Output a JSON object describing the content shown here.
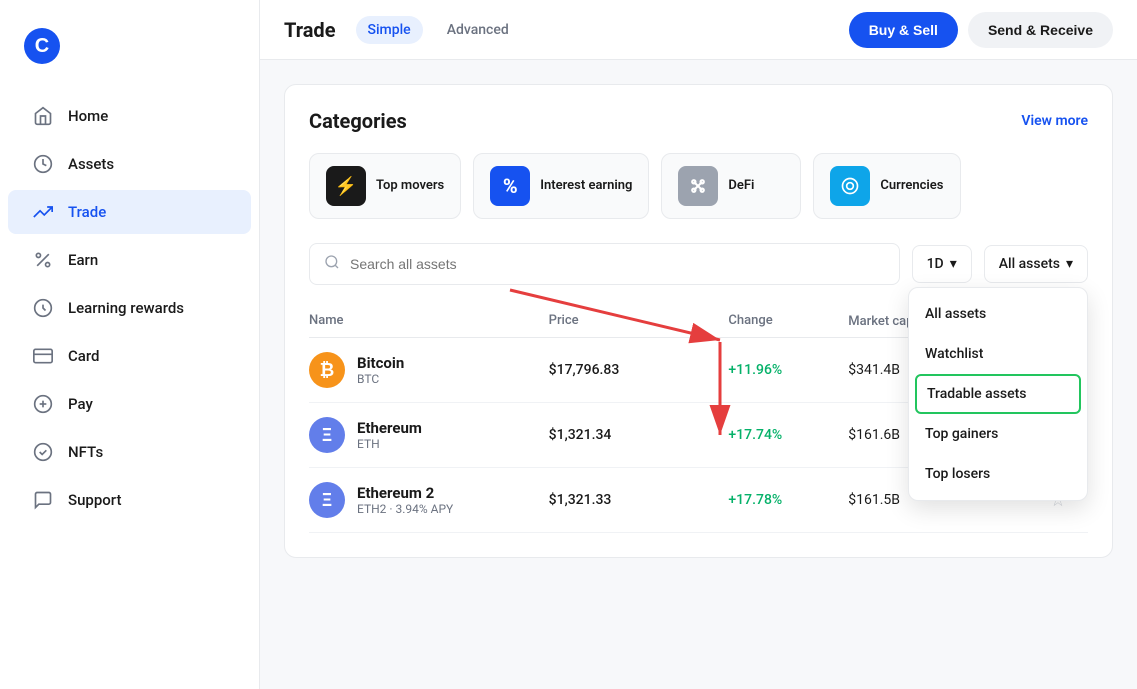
{
  "sidebar": {
    "logo": "C",
    "items": [
      {
        "label": "Home",
        "icon": "home",
        "active": false
      },
      {
        "label": "Assets",
        "icon": "assets",
        "active": false
      },
      {
        "label": "Trade",
        "icon": "trade",
        "active": true
      },
      {
        "label": "Earn",
        "icon": "earn",
        "active": false
      },
      {
        "label": "Learning rewards",
        "icon": "learning",
        "active": false
      },
      {
        "label": "Card",
        "icon": "card",
        "active": false
      },
      {
        "label": "Pay",
        "icon": "pay",
        "active": false
      },
      {
        "label": "NFTs",
        "icon": "nfts",
        "active": false
      },
      {
        "label": "Support",
        "icon": "support",
        "active": false
      }
    ]
  },
  "header": {
    "title": "Trade",
    "tabs": [
      {
        "label": "Simple",
        "active": true
      },
      {
        "label": "Advanced",
        "active": false
      }
    ],
    "buttons": {
      "primary": "Buy & Sell",
      "secondary": "Send & Receive"
    }
  },
  "categories": {
    "title": "Categories",
    "view_more": "View more",
    "items": [
      {
        "label": "Top movers",
        "icon_type": "black",
        "icon": "⚡"
      },
      {
        "label": "Interest earning",
        "icon_type": "blue",
        "icon": "%"
      },
      {
        "label": "DeFi",
        "icon_type": "gray",
        "icon": "⤢"
      },
      {
        "label": "Currencies",
        "icon_type": "teal",
        "icon": "★"
      }
    ]
  },
  "search": {
    "placeholder": "Search all assets"
  },
  "time_filter": {
    "value": "1D",
    "label": "1D"
  },
  "asset_filter": {
    "current": "All assets",
    "options": [
      {
        "label": "All assets",
        "highlighted": false
      },
      {
        "label": "Watchlist",
        "highlighted": false
      },
      {
        "label": "Tradable assets",
        "highlighted": true
      },
      {
        "label": "Top gainers",
        "highlighted": false
      },
      {
        "label": "Top losers",
        "highlighted": false
      }
    ]
  },
  "table": {
    "columns": [
      "Name",
      "Price",
      "Change",
      "Market cap"
    ],
    "rows": [
      {
        "name": "Bitcoin",
        "symbol": "BTC",
        "price": "$17,796.83",
        "change": "+11.96%",
        "change_type": "positive",
        "market_cap": "$341.4B",
        "icon_color": "#f7931a",
        "icon_letter": "₿"
      },
      {
        "name": "Ethereum",
        "symbol": "ETH",
        "price": "$1,321.34",
        "change": "+17.74%",
        "change_type": "positive",
        "market_cap": "$161.6B",
        "icon_color": "#627eea",
        "icon_letter": "Ξ"
      },
      {
        "name": "Ethereum 2",
        "symbol": "ETH2 · 3.94% APY",
        "price": "$1,321.33",
        "change": "+17.78%",
        "change_type": "positive",
        "market_cap": "$161.5B",
        "icon_color": "#627eea",
        "icon_letter": "Ξ"
      }
    ]
  }
}
